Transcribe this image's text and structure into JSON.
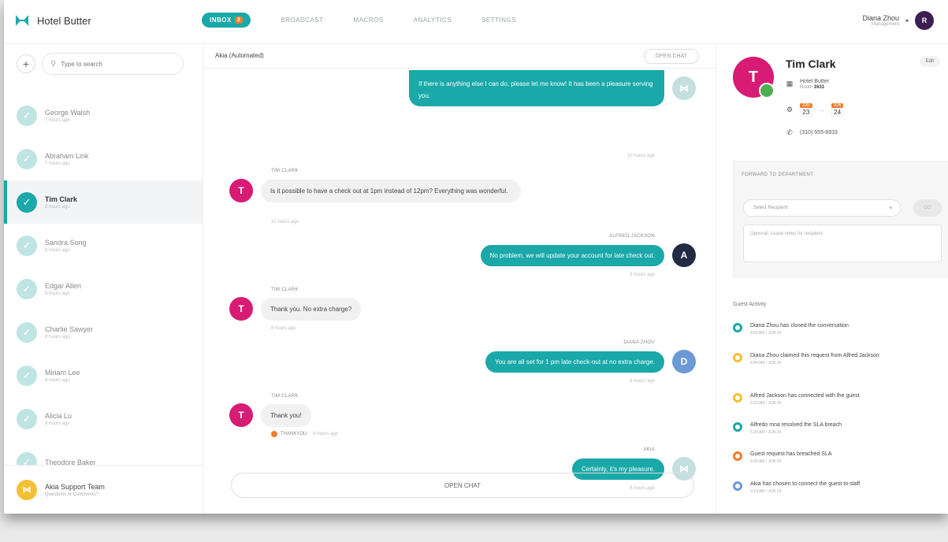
{
  "brand": {
    "name": "Hotel Butter"
  },
  "nav": {
    "tabs": [
      {
        "label": "INBOX",
        "badge": "2"
      },
      {
        "label": "BROADCAST"
      },
      {
        "label": "MACROS"
      },
      {
        "label": "ANALYTICS"
      },
      {
        "label": "SETTINGS"
      }
    ]
  },
  "user": {
    "name": "Diana Zhou",
    "role": "Management",
    "initial": "R"
  },
  "sidebar": {
    "search_placeholder": "Type to search",
    "conversations": [
      {
        "name": "George Walsh",
        "time": "7 hours ago"
      },
      {
        "name": "Abraham Link",
        "time": "7 hours ago"
      },
      {
        "name": "Tim Clark",
        "time": "8 hours ago"
      },
      {
        "name": "Sandra Song",
        "time": "8 hours ago"
      },
      {
        "name": "Edgar Allen",
        "time": "8 hours ago"
      },
      {
        "name": "Charlie Sawyer",
        "time": "8 hours ago"
      },
      {
        "name": "Miriam Lee",
        "time": "8 hours ago"
      },
      {
        "name": "Alicia Lu",
        "time": "8 hours ago"
      },
      {
        "name": "Theodore Baker",
        "time": ""
      }
    ],
    "support": {
      "name": "Akia Support Team",
      "sub": "Questions or Comments?"
    }
  },
  "chat": {
    "title": "Akia (Automated)",
    "open_chat_small": "OPEN CHAT",
    "messages": {
      "m1": {
        "text": "If there is anything else I can do, please let me know! It has been a pleasure serving you.",
        "time": "10 hours ago"
      },
      "m2": {
        "sender": "TIM CLARK",
        "text": "Is it possible to have a check out at 1pm instead of 12pm? Everything was wonderful.",
        "time": "10 hours ago"
      },
      "m3": {
        "sender": "ALFRED JACKSON",
        "text": "No problem, we will update your account for late check out.",
        "time": "9 hours ago",
        "initial": "A"
      },
      "m4": {
        "sender": "TIM CLARK",
        "text": "Thank you. No extra charge?",
        "time": "8 hours ago"
      },
      "m5": {
        "sender": "DIANA ZHOU",
        "text": "You are all set for 1 pm late check-out at no extra charge.",
        "time": "8 hours ago",
        "initial": "D"
      },
      "m6": {
        "sender": "TIM CLARK",
        "text": "Thank you!",
        "tag": "THANKYOU",
        "tag_time": "8 hours ago"
      },
      "m7": {
        "sender": "AKIA",
        "text": "Certainly, it's my pleasure.",
        "time": "8 hours ago"
      }
    },
    "guest_initial": "T",
    "open_chat_button": "OPEN CHAT"
  },
  "details": {
    "guest_name": "Tim Clark",
    "guest_initial": "T",
    "edit_label": "Edit",
    "hotel": "Hotel Butter",
    "room_label": "Room",
    "room_number": "1631",
    "checkin": {
      "month": "JUN",
      "day": "23"
    },
    "checkout": {
      "month": "JUN",
      "day": "24"
    },
    "phone": "(310) 555-8933",
    "forward": {
      "title": "FORWARD TO DEPARTMENT",
      "select_placeholder": "Select Recipient",
      "go_label": "GO",
      "notes_placeholder": "Optional, Leave notes for recipient."
    },
    "activity_title": "Guest Activity",
    "activity": [
      {
        "text": "Diana Zhou has closed the conversation",
        "time": "8:50 AM / JUN 24",
        "color": "#1aa8a8"
      },
      {
        "text": "Diana Zhou claimed this request from Alfred Jackson",
        "time": "8:44 AM / JUN 24",
        "color": "#f4c033"
      },
      {
        "text": "Alfred Jackson has connected with the guest",
        "time": "5:20 AM / JUN 24",
        "color": "#f4c033"
      },
      {
        "text": "Alfredo mna resolved the SLA breach",
        "time": "5:20 AM / JUN 24",
        "color": "#1aa8a8"
      },
      {
        "text": "Guest request has breached SLA",
        "time": "5:00 AM / JUN 24",
        "color": "#f07c2b"
      },
      {
        "text": "Akia has chosen to connect the guest to staff",
        "time": "3:19 AM / JUN 24",
        "color": "#6b9ad6"
      }
    ]
  }
}
